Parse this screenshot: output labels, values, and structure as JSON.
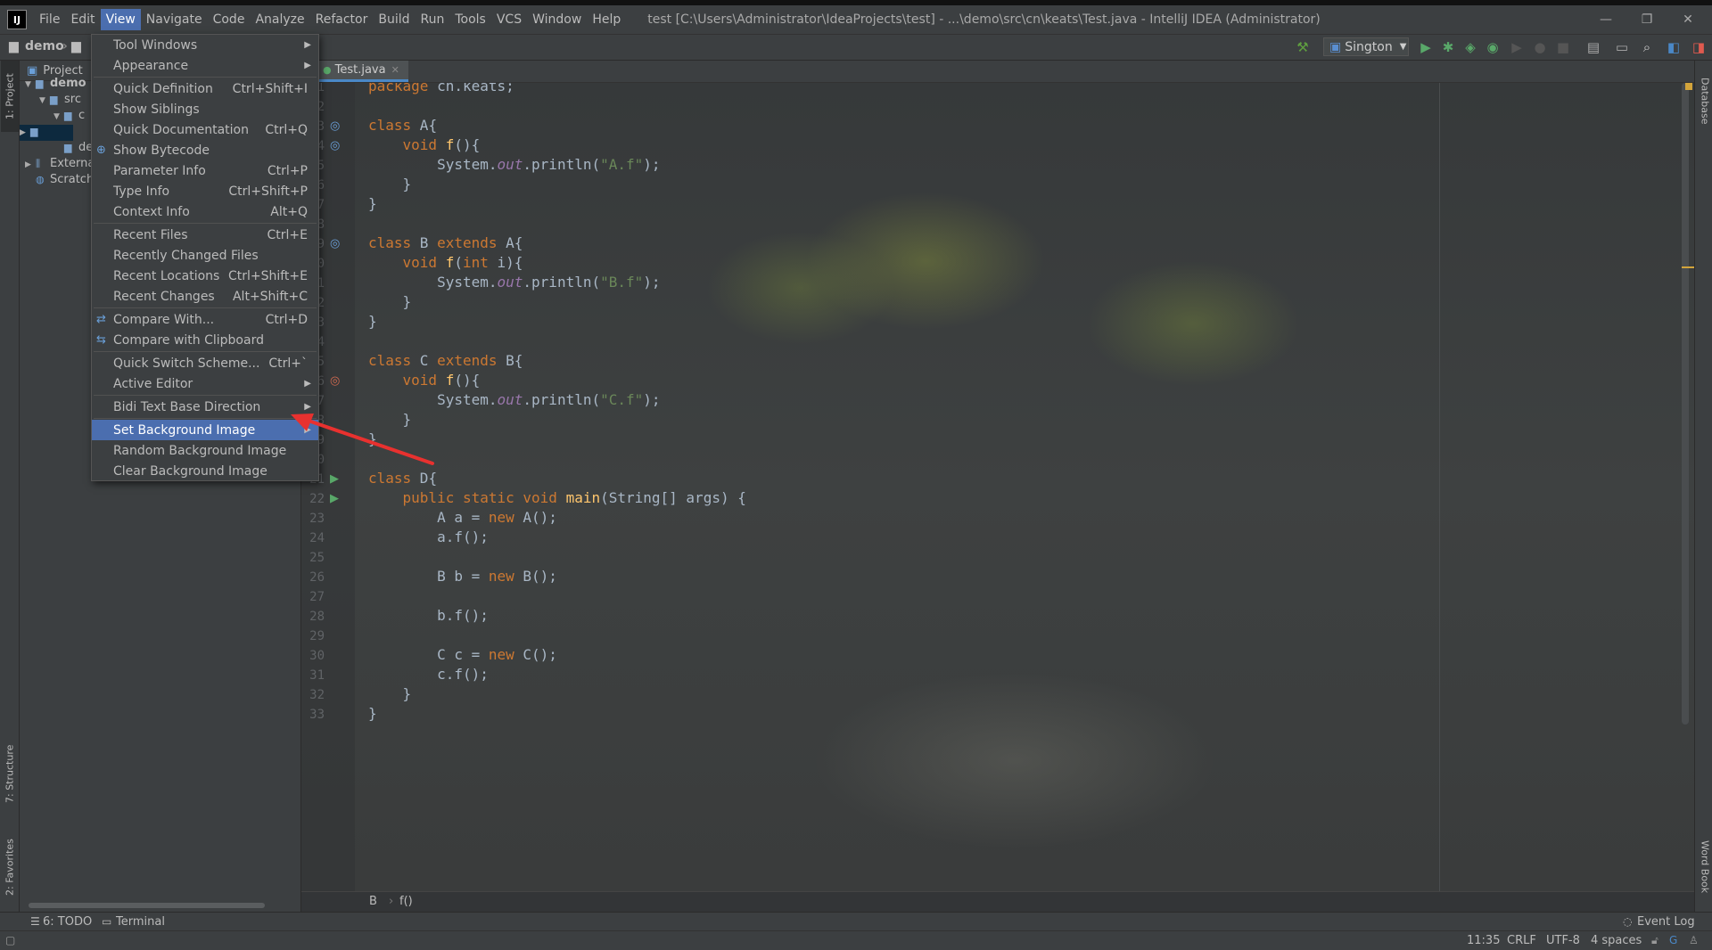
{
  "app": {
    "logo": "IJ"
  },
  "menubar": {
    "items": [
      "File",
      "Edit",
      "View",
      "Navigate",
      "Code",
      "Analyze",
      "Refactor",
      "Build",
      "Run",
      "Tools",
      "VCS",
      "Window",
      "Help"
    ],
    "active_index": 2
  },
  "window_title": "test [C:\\Users\\Administrator\\IdeaProjects\\test] - ...\\demo\\src\\cn\\keats\\Test.java - IntelliJ IDEA (Administrator)",
  "window_buttons": {
    "minimize": "—",
    "restore": "❐",
    "close": "✕"
  },
  "navbar": {
    "crumb_project": "demo",
    "run_config": "Sington"
  },
  "left_strip": {
    "project_tab": "1: Project",
    "structure_tab": "7: Structure",
    "favorites_tab": "2: Favorites"
  },
  "right_strip": {
    "database_tab": "Database",
    "wordbook_tab": "Word Book"
  },
  "project_panel": {
    "title": "Project",
    "tree": [
      {
        "label": "demo",
        "indent": 0
      },
      {
        "label": "src",
        "indent": 1
      },
      {
        "label": "c",
        "indent": 2
      },
      {
        "label": "",
        "indent": 3
      },
      {
        "label": "dem",
        "indent": 2
      },
      {
        "label": "Externa",
        "indent": 0
      },
      {
        "label": "Scratch",
        "indent": 0
      }
    ]
  },
  "editor": {
    "tab_label": "Test.java",
    "breadcrumb": [
      "B",
      "f()"
    ]
  },
  "code_lines": [
    {
      "n": "1",
      "html": "<span class=\"kw\">package</span> cn.keats;"
    },
    {
      "n": "2",
      "html": ""
    },
    {
      "n": "3",
      "html": "<span class=\"kw\">class</span> A{"
    },
    {
      "n": "4",
      "html": "    <span class=\"kw\">void</span> <span class=\"fn\">f</span>(){"
    },
    {
      "n": "5",
      "html": "        System.<span class=\"it\">out</span>.println(<span class=\"st\">\"A.f\"</span>);"
    },
    {
      "n": "6",
      "html": "    }"
    },
    {
      "n": "7",
      "html": "}"
    },
    {
      "n": "8",
      "html": ""
    },
    {
      "n": "9",
      "html": "<span class=\"kw\">class</span> B <span class=\"kw\">extends</span> A{"
    },
    {
      "n": "10",
      "html": "    <span class=\"kw\">void</span> <span class=\"fn\">f</span>(<span class=\"kw\">int</span> i){"
    },
    {
      "n": "11",
      "html": "        System.<span class=\"it\">out</span>.println(<span class=\"st\">\"B.f\"</span>);"
    },
    {
      "n": "12",
      "html": "    }"
    },
    {
      "n": "13",
      "html": "}"
    },
    {
      "n": "14",
      "html": ""
    },
    {
      "n": "15",
      "html": "<span class=\"kw\">class</span> C <span class=\"kw\">extends</span> B{"
    },
    {
      "n": "16",
      "html": "    <span class=\"kw\">void</span> <span class=\"fn\">f</span>(){"
    },
    {
      "n": "17",
      "html": "        System.<span class=\"it\">out</span>.println(<span class=\"st\">\"C.f\"</span>);"
    },
    {
      "n": "18",
      "html": "    }"
    },
    {
      "n": "19",
      "html": "}"
    },
    {
      "n": "20",
      "html": ""
    },
    {
      "n": "21",
      "html": "<span class=\"kw\">class</span> D{"
    },
    {
      "n": "22",
      "html": "    <span class=\"kw\">public static void</span> <span class=\"fn\">main</span>(String[] args) {"
    },
    {
      "n": "23",
      "html": "        A a = <span class=\"kw\">new</span> A();"
    },
    {
      "n": "24",
      "html": "        a.f();"
    },
    {
      "n": "25",
      "html": ""
    },
    {
      "n": "26",
      "html": "        B b = <span class=\"kw\">new</span> B();"
    },
    {
      "n": "27",
      "html": ""
    },
    {
      "n": "28",
      "html": "        b.f();"
    },
    {
      "n": "29",
      "html": ""
    },
    {
      "n": "30",
      "html": "        C c = <span class=\"kw\">new</span> C();"
    },
    {
      "n": "31",
      "html": "        c.f();"
    },
    {
      "n": "32",
      "html": "    }"
    },
    {
      "n": "33",
      "html": "}"
    }
  ],
  "view_menu": {
    "items": [
      {
        "label": "Tool Windows",
        "shortcut": "",
        "submenu": true
      },
      {
        "label": "Appearance",
        "shortcut": "",
        "submenu": true
      },
      {
        "sep": true
      },
      {
        "label": "Quick Definition",
        "shortcut": "Ctrl+Shift+I"
      },
      {
        "label": "Show Siblings",
        "shortcut": ""
      },
      {
        "label": "Quick Documentation",
        "shortcut": "Ctrl+Q"
      },
      {
        "label": "Show Bytecode",
        "shortcut": "",
        "icon": "bytecode-icon"
      },
      {
        "label": "Parameter Info",
        "shortcut": "Ctrl+P"
      },
      {
        "label": "Type Info",
        "shortcut": "Ctrl+Shift+P"
      },
      {
        "label": "Context Info",
        "shortcut": "Alt+Q"
      },
      {
        "sep": true
      },
      {
        "label": "Recent Files",
        "shortcut": "Ctrl+E"
      },
      {
        "label": "Recently Changed Files",
        "shortcut": ""
      },
      {
        "label": "Recent Locations",
        "shortcut": "Ctrl+Shift+E"
      },
      {
        "label": "Recent Changes",
        "shortcut": "Alt+Shift+C"
      },
      {
        "sep": true
      },
      {
        "label": "Compare With...",
        "shortcut": "Ctrl+D",
        "icon": "compare-icon"
      },
      {
        "label": "Compare with Clipboard",
        "shortcut": "",
        "icon": "clipboard-compare-icon"
      },
      {
        "sep": true
      },
      {
        "label": "Quick Switch Scheme...",
        "shortcut": "Ctrl+`"
      },
      {
        "label": "Active Editor",
        "shortcut": "",
        "submenu": true
      },
      {
        "sep": true
      },
      {
        "label": "Bidi Text Base Direction",
        "shortcut": "",
        "submenu": true
      },
      {
        "sep": true
      },
      {
        "label": "Set Background Image",
        "shortcut": "",
        "submenu": true,
        "selected": true
      },
      {
        "label": "Random Background Image",
        "shortcut": ""
      },
      {
        "label": "Clear Background Image",
        "shortcut": ""
      }
    ]
  },
  "bottom_tabs": {
    "todo": "6: TODO",
    "terminal": "Terminal",
    "event_log": "Event Log"
  },
  "status": {
    "position": "11:35",
    "line_sep": "CRLF",
    "encoding": "UTF-8",
    "indent": "4 spaces"
  },
  "colors": {
    "accent": "#4b6eaf",
    "keyword": "#cc7832",
    "function": "#ffc66d",
    "string": "#6a8759",
    "field": "#9876aa",
    "arrow": "#e8312f"
  }
}
